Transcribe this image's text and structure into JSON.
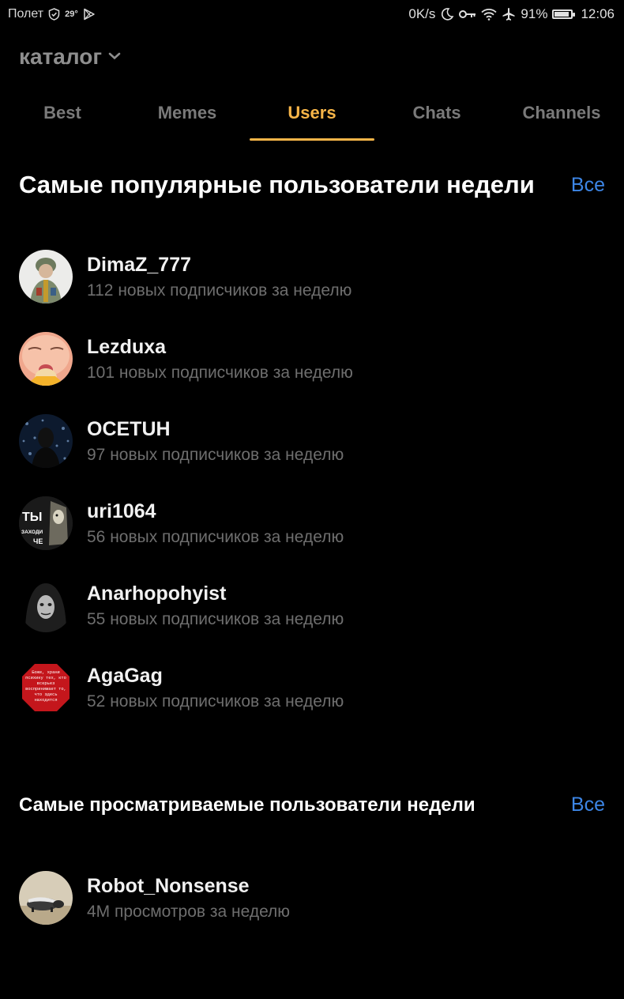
{
  "status_bar": {
    "carrier": "Полет",
    "temperature": "29°",
    "net_speed": "0K/s",
    "battery_percent": "91%",
    "battery_level": 0.91,
    "time": "12:06",
    "icons": [
      "shield-icon",
      "play-store-icon",
      "moon-icon",
      "key-icon",
      "wifi-icon",
      "airplane-icon",
      "battery-icon"
    ]
  },
  "header": {
    "title": "каталог"
  },
  "tabs": [
    {
      "label": "Best",
      "active": false
    },
    {
      "label": "Memes",
      "active": false
    },
    {
      "label": "Users",
      "active": true
    },
    {
      "label": "Chats",
      "active": false
    },
    {
      "label": "Channels",
      "active": false
    }
  ],
  "colors": {
    "accent": "#f7b548",
    "link": "#3d86e6",
    "background": "#000000",
    "secondary_text": "#6e6e6e"
  },
  "popular_section": {
    "title": "Самые популярные пользователи недели",
    "see_all": "Все",
    "users": [
      {
        "name": "DimaZ_777",
        "subtitle": "112 новых подписчиков за неделю"
      },
      {
        "name": "Lezduxa",
        "subtitle": "101 новых подписчиков за неделю"
      },
      {
        "name": "OCETUH",
        "subtitle": "97 новых подписчиков за неделю"
      },
      {
        "name": "uri1064",
        "subtitle": "56 новых подписчиков за неделю"
      },
      {
        "name": "Anarhopohyist",
        "subtitle": "55 новых подписчиков за неделю"
      },
      {
        "name": "AgaGag",
        "subtitle": "52 новых подписчиков за неделю"
      }
    ]
  },
  "viewed_section": {
    "title": "Самые просматриваемые пользователи недели",
    "see_all": "Все",
    "users": [
      {
        "name": "Robot_Nonsense",
        "subtitle": "4M просмотров за неделю"
      }
    ]
  },
  "avatar_text": {
    "uri1064": [
      "ТЫ",
      "ЗАХОДИ",
      "ЧЕ"
    ],
    "agagag": [
      "Боже, храни",
      "психику тех, кто",
      "всерьез",
      "воспринимает то,",
      "что здесь",
      "находится"
    ]
  }
}
